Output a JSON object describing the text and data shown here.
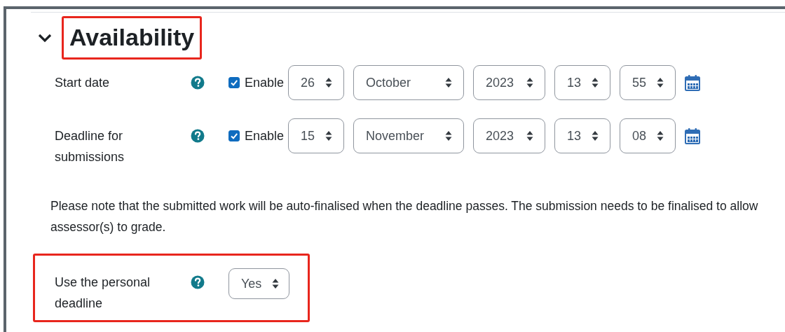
{
  "section": {
    "title": "Availability",
    "expanded": true,
    "highlighted": true
  },
  "date_fields": [
    {
      "label": "Start date",
      "enabled": true,
      "enable_label": "Enable",
      "day": "26",
      "month": "October",
      "year": "2023",
      "hour": "13",
      "minute": "55"
    },
    {
      "label": "Deadline for submissions",
      "enabled": true,
      "enable_label": "Enable",
      "day": "15",
      "month": "November",
      "year": "2023",
      "hour": "13",
      "minute": "08"
    }
  ],
  "note": "Please note that the submitted work will be auto-finalised when the deadline passes. The submission needs to be finalised to allow assessor(s) to grade.",
  "personal_deadline": {
    "label": "Use the personal deadline",
    "value": "Yes",
    "highlighted": true
  }
}
